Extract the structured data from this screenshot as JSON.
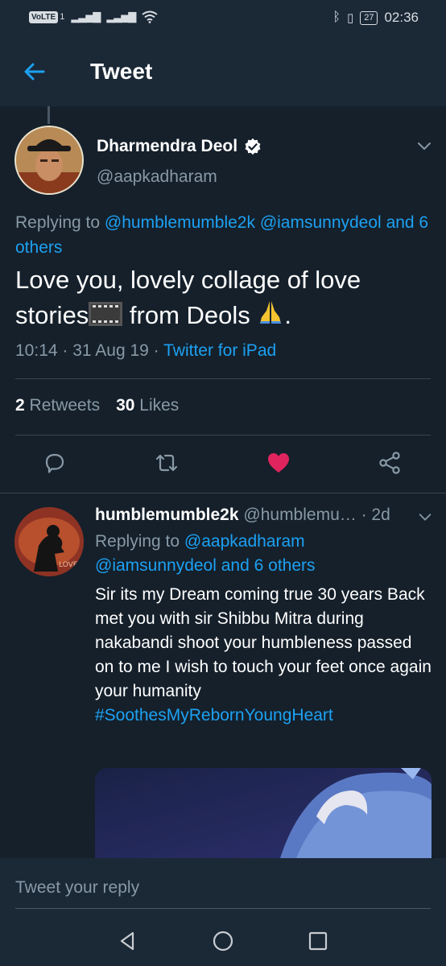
{
  "status_bar": {
    "volte": "VoLTE",
    "sim": "1",
    "battery": "27",
    "time": "02:36"
  },
  "header": {
    "title": "Tweet"
  },
  "tweet": {
    "author_name": "Dharmendra Deol",
    "author_handle": "@aapkadharam",
    "replying_prefix": "Replying to",
    "replying_user1": "@humblemumble2k",
    "replying_user2": "@iamsunnydeol",
    "replying_others": "and 6 others",
    "text_part1": "Love you, lovely collage of love stories",
    "text_part2": " from Deols ",
    "text_part3": ".",
    "time": "10:14",
    "date": "31 Aug 19",
    "source": "Twitter for iPad",
    "retweet_count": "2",
    "retweet_label": "Retweets",
    "like_count": "30",
    "like_label": "Likes",
    "liked": true,
    "like_color": "#e0245e"
  },
  "reply": {
    "author_name": "humblemumble2k",
    "author_handle": "@humblemu…",
    "age": "· 2d",
    "replying_prefix": "Replying to",
    "replying_user1": "@aapkadharam",
    "replying_user2": "@iamsunnydeol",
    "replying_others": "and 6 others",
    "text": "Sir its my Dream coming true 30 years Back met you with sir Shibbu Mitra during nakabandi shoot your humbleness passed on to me I wish to touch your feet once again your humanity",
    "hashtag": "#SoothesMyRebornYoungHeart"
  },
  "reply_bar": {
    "placeholder": "Tweet your reply"
  },
  "colors": {
    "background": "#15202b",
    "header": "#1b2836",
    "accent": "#1da1f2",
    "secondary_text": "#8899a6"
  }
}
